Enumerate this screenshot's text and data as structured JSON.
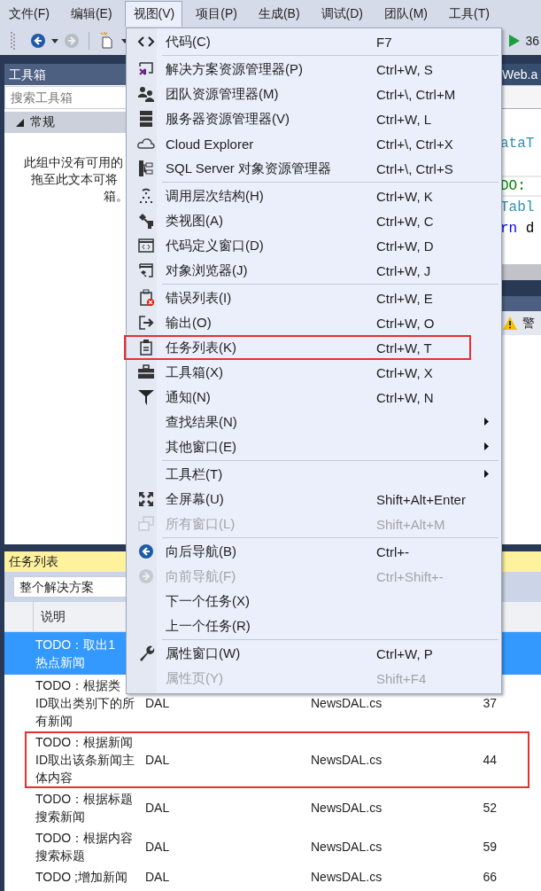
{
  "menubar": [
    {
      "label": "文件(F)",
      "selected": false
    },
    {
      "label": "编辑(E)",
      "selected": false
    },
    {
      "label": "视图(V)",
      "selected": true
    },
    {
      "label": "项目(P)",
      "selected": false
    },
    {
      "label": "生成(B)",
      "selected": false
    },
    {
      "label": "调试(D)",
      "selected": false
    },
    {
      "label": "团队(M)",
      "selected": false
    },
    {
      "label": "工具(T)",
      "selected": false
    }
  ],
  "toolbar": {
    "counter": "36"
  },
  "toolbox": {
    "title": "工具箱",
    "search": {
      "placeholder": "搜索工具箱"
    },
    "group": {
      "label": "常规",
      "expanded": true
    },
    "empty_text_lines": [
      "此组中没有可用的",
      "拖至此文本可将",
      "箱。"
    ]
  },
  "editor": {
    "tab": "Web.a",
    "code_lines": [
      [
        {
          "text": "ataT",
          "kind": "type"
        }
      ],
      [
        {
          "text": "DO:",
          "kind": "comment"
        }
      ],
      [
        {
          "text": "Tabl",
          "kind": "type"
        }
      ],
      [
        {
          "text": "rn",
          "kind": "keyword"
        },
        {
          "text": " d",
          "kind": "plain"
        }
      ]
    ],
    "warning": "警"
  },
  "view_menu": {
    "groups": [
      [
        {
          "label": "代码(C)",
          "shortcut": "F7",
          "disabled": false,
          "submenu": false,
          "annotated": false
        }
      ],
      [
        {
          "label": "解决方案资源管理器(P)",
          "shortcut": "Ctrl+W, S",
          "disabled": false,
          "submenu": false,
          "annotated": false
        },
        {
          "label": "团队资源管理器(M)",
          "shortcut": "Ctrl+\\, Ctrl+M",
          "disabled": false,
          "submenu": false,
          "annotated": false
        },
        {
          "label": "服务器资源管理器(V)",
          "shortcut": "Ctrl+W, L",
          "disabled": false,
          "submenu": false,
          "annotated": false
        },
        {
          "label": "Cloud Explorer",
          "shortcut": "Ctrl+\\, Ctrl+X",
          "disabled": false,
          "submenu": false,
          "annotated": false
        },
        {
          "label": "SQL Server 对象资源管理器",
          "shortcut": "Ctrl+\\, Ctrl+S",
          "disabled": false,
          "submenu": false,
          "annotated": false
        }
      ],
      [
        {
          "label": "调用层次结构(H)",
          "shortcut": "Ctrl+W, K",
          "disabled": false,
          "submenu": false,
          "annotated": false
        },
        {
          "label": "类视图(A)",
          "shortcut": "Ctrl+W, C",
          "disabled": false,
          "submenu": false,
          "annotated": false
        },
        {
          "label": "代码定义窗口(D)",
          "shortcut": "Ctrl+W, D",
          "disabled": false,
          "submenu": false,
          "annotated": false
        },
        {
          "label": "对象浏览器(J)",
          "shortcut": "Ctrl+W, J",
          "disabled": false,
          "submenu": false,
          "annotated": false
        }
      ],
      [
        {
          "label": "错误列表(I)",
          "shortcut": "Ctrl+W, E",
          "disabled": false,
          "submenu": false,
          "annotated": false
        },
        {
          "label": "输出(O)",
          "shortcut": "Ctrl+W, O",
          "disabled": false,
          "submenu": false,
          "annotated": false
        },
        {
          "label": "任务列表(K)",
          "shortcut": "Ctrl+W, T",
          "disabled": false,
          "submenu": false,
          "annotated": true
        },
        {
          "label": "工具箱(X)",
          "shortcut": "Ctrl+W, X",
          "disabled": false,
          "submenu": false,
          "annotated": false
        },
        {
          "label": "通知(N)",
          "shortcut": "Ctrl+W, N",
          "disabled": false,
          "submenu": false,
          "annotated": false
        },
        {
          "label": "查找结果(N)",
          "disabled": false,
          "submenu": true,
          "annotated": false
        },
        {
          "label": "其他窗口(E)",
          "disabled": false,
          "submenu": true,
          "annotated": false
        }
      ],
      [
        {
          "label": "工具栏(T)",
          "disabled": false,
          "submenu": true,
          "annotated": false
        },
        {
          "label": "全屏幕(U)",
          "shortcut": "Shift+Alt+Enter",
          "disabled": false,
          "submenu": false,
          "annotated": false
        },
        {
          "label": "所有窗口(L)",
          "shortcut": "Shift+Alt+M",
          "disabled": true,
          "submenu": false,
          "annotated": false
        }
      ],
      [
        {
          "label": "向后导航(B)",
          "shortcut": "Ctrl+-",
          "disabled": false,
          "submenu": false,
          "annotated": false
        },
        {
          "label": "向前导航(F)",
          "shortcut": "Ctrl+Shift+-",
          "disabled": true,
          "submenu": false,
          "annotated": false
        },
        {
          "label": "下一个任务(X)",
          "disabled": false,
          "submenu": false,
          "annotated": false
        },
        {
          "label": "上一个任务(R)",
          "disabled": false,
          "submenu": false,
          "annotated": false
        }
      ],
      [
        {
          "label": "属性窗口(W)",
          "shortcut": "Ctrl+W, P",
          "disabled": false,
          "submenu": false,
          "annotated": false
        },
        {
          "label": "属性页(Y)",
          "shortcut": "Shift+F4",
          "disabled": true,
          "submenu": false,
          "annotated": false
        }
      ]
    ]
  },
  "task_list": {
    "title": "任务列表",
    "scope": {
      "value": "整个解决方案"
    },
    "columns": [
      {
        "label": "说明"
      }
    ],
    "rows": [
      {
        "selected": true,
        "annotated": false,
        "description_lines": [
          "TODO：取出1",
          "热点新闻"
        ]
      },
      {
        "selected": false,
        "annotated": false,
        "description_lines": [
          "TODO：根据类",
          "ID取出类别下的所",
          "有新闻"
        ],
        "project": "DAL",
        "file": "NewsDAL.cs",
        "line": "37"
      },
      {
        "selected": false,
        "annotated": true,
        "description_lines": [
          "TODO：根据新闻",
          "ID取出该条新闻主",
          "体内容"
        ],
        "project": "DAL",
        "file": "NewsDAL.cs",
        "line": "44"
      },
      {
        "selected": false,
        "annotated": false,
        "description_lines": [
          "TODO：根据标题",
          "搜索新闻"
        ],
        "project": "DAL",
        "file": "NewsDAL.cs",
        "line": "52"
      },
      {
        "selected": false,
        "annotated": false,
        "description_lines": [
          "TODO：根据内容",
          "搜索标题"
        ],
        "project": "DAL",
        "file": "NewsDAL.cs",
        "line": "59"
      },
      {
        "selected": false,
        "annotated": false,
        "description_lines": [
          "TODO ;增加新闻"
        ],
        "project": "DAL",
        "file": "NewsDAL.cs",
        "line": "66"
      }
    ]
  }
}
